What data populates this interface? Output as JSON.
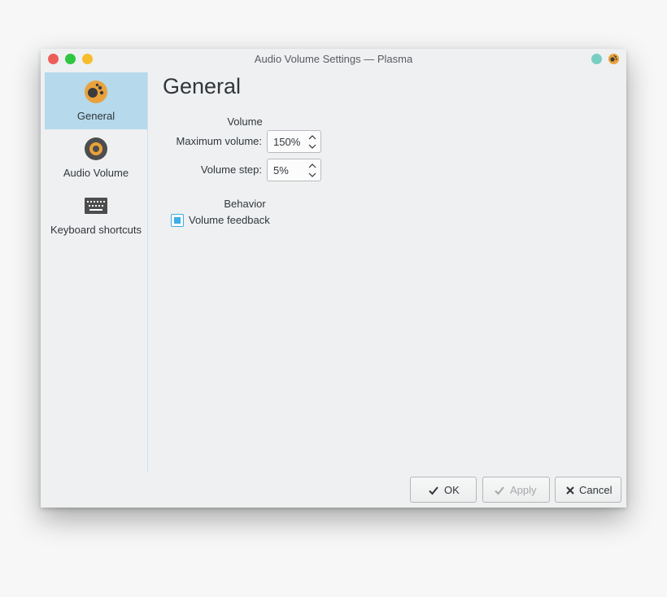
{
  "window": {
    "title": "Audio Volume Settings — Plasma",
    "traffic_lights": [
      "close",
      "maximize",
      "minimize"
    ],
    "colors": {
      "close": "#ec5f59",
      "maximize": "#2ec73f",
      "minimize": "#f5bd2b",
      "pin": "#79cec4"
    }
  },
  "sidebar": {
    "items": [
      {
        "label": "General",
        "icon": "general-icon",
        "active": true
      },
      {
        "label": "Audio Volume",
        "icon": "audio-volume-icon",
        "active": false
      },
      {
        "label": "Keyboard shortcuts",
        "icon": "keyboard-icon",
        "active": false
      }
    ],
    "active_color": "#b6d9ec"
  },
  "page": {
    "title": "General",
    "volume": {
      "heading": "Volume",
      "max_label": "Maximum volume:",
      "max_value": "150%",
      "step_label": "Volume step:",
      "step_value": "5%"
    },
    "behavior": {
      "heading": "Behavior",
      "feedback_label": "Volume feedback",
      "feedback_checked": true
    }
  },
  "buttons": {
    "ok": "OK",
    "apply": "Apply",
    "cancel": "Cancel"
  },
  "accent_color": "#3daee9"
}
